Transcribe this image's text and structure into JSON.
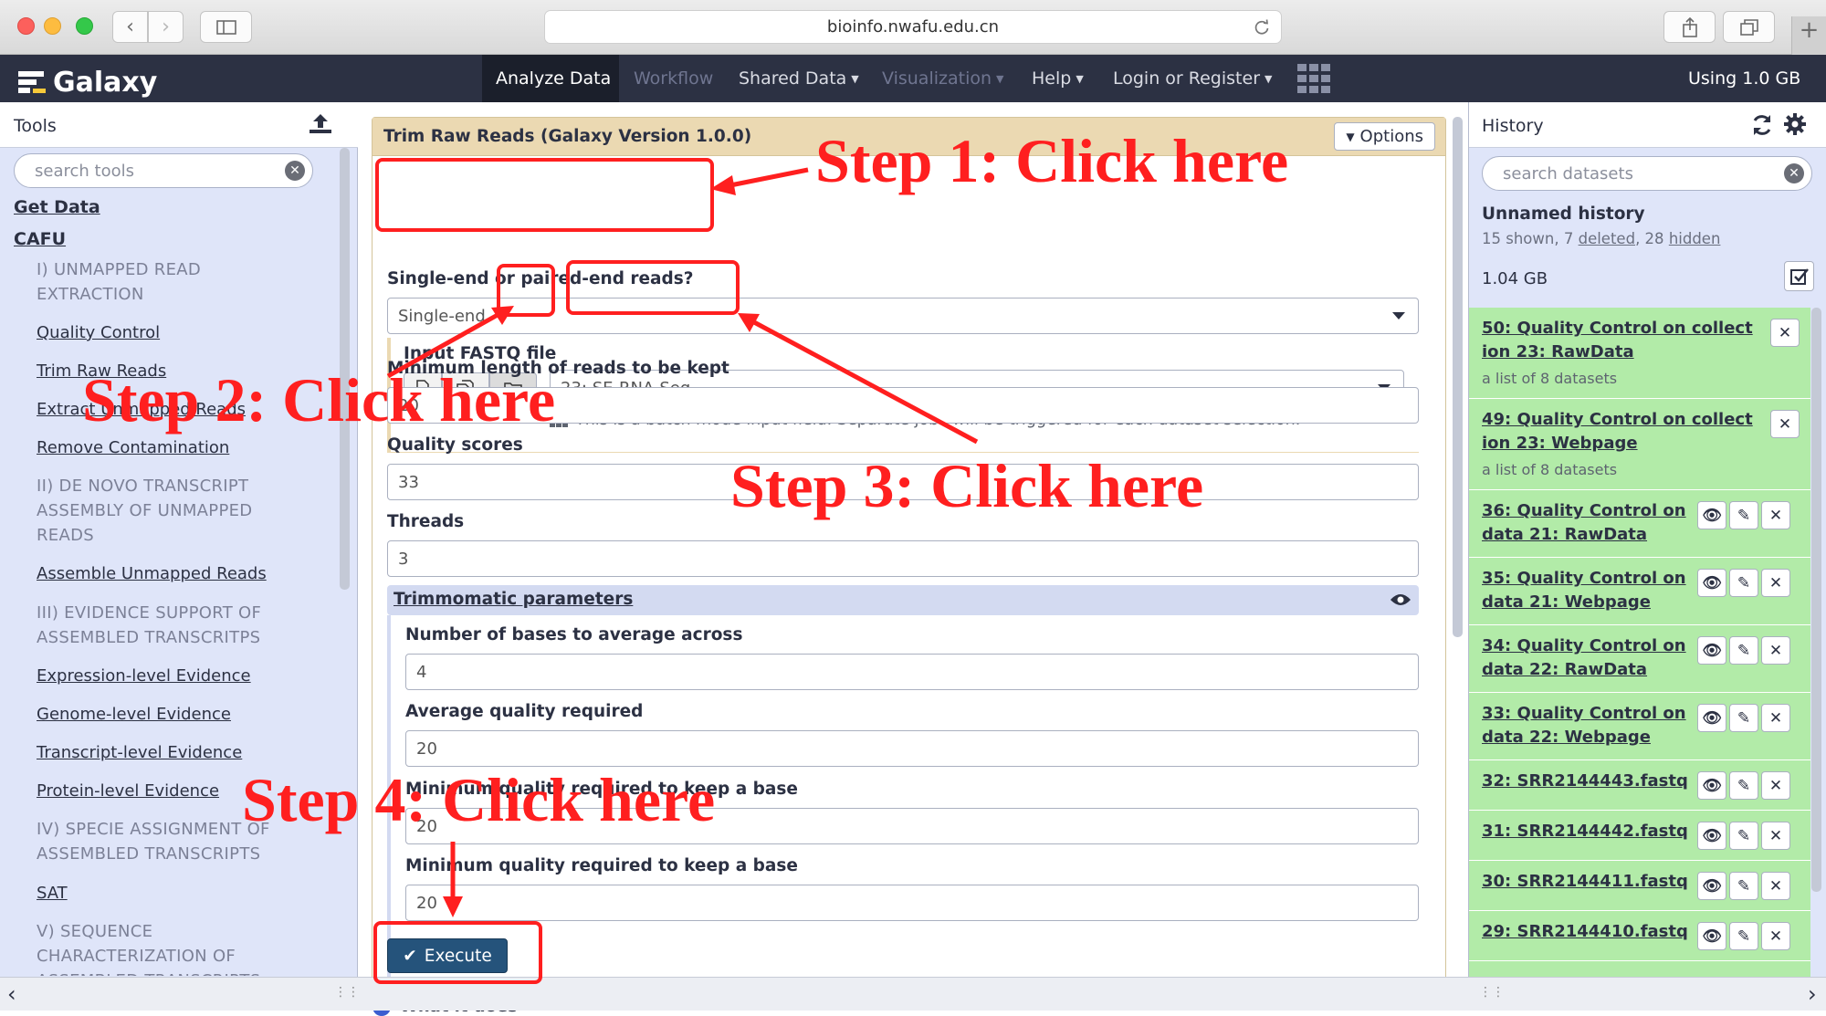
{
  "browser": {
    "url": "bioinfo.nwafu.edu.cn"
  },
  "masthead": {
    "brand": "Galaxy",
    "nav": [
      {
        "label": "Analyze Data"
      },
      {
        "label": "Workflow"
      },
      {
        "label": "Shared Data"
      },
      {
        "label": "Visualization"
      },
      {
        "label": "Help"
      },
      {
        "label": "Login or Register"
      }
    ],
    "usage": "Using 1.0 GB"
  },
  "tools": {
    "title": "Tools",
    "search_placeholder": "search tools",
    "items": [
      {
        "type": "head",
        "label": "Get Data"
      },
      {
        "type": "head",
        "label": "CAFU"
      },
      {
        "type": "section",
        "label": "I) UNMAPPED READ EXTRACTION"
      },
      {
        "type": "link",
        "label": "Quality Control"
      },
      {
        "type": "link",
        "label": "Trim Raw Reads"
      },
      {
        "type": "link",
        "label": "Extract Unmapped Reads"
      },
      {
        "type": "link",
        "label": "Remove Contamination"
      },
      {
        "type": "section",
        "label": "II) DE NOVO TRANSCRIPT ASSEMBLY OF UNMAPPED READS"
      },
      {
        "type": "link",
        "label": "Assemble Unmapped Reads"
      },
      {
        "type": "section",
        "label": "III) EVIDENCE SUPPORT OF ASSEMBLED TRANSCRITPS"
      },
      {
        "type": "link",
        "label": "Expression-level Evidence"
      },
      {
        "type": "link",
        "label": "Genome-level Evidence"
      },
      {
        "type": "link",
        "label": "Transcript-level Evidence"
      },
      {
        "type": "link",
        "label": "Protein-level Evidence"
      },
      {
        "type": "section",
        "label": "IV) SPECIE ASSIGNMENT OF ASSEMBLED TRANSCRIPTS"
      },
      {
        "type": "link",
        "label": "SAT"
      },
      {
        "type": "section",
        "label": "V) SEQUENCE CHARACTERIZATION OF ASSEMBLED TRANSCRIPTS"
      }
    ]
  },
  "form": {
    "title": "Trim Raw Reads (Galaxy Version 1.0.0)",
    "options_label": "Options",
    "reads_label": "Single-end or paired-end reads?",
    "reads_value": "Single-end",
    "fastq_label": "Input FASTQ file",
    "fastq_value": "23: SE-RNA-Seq",
    "batch_help": "This is a batch mode input field. Separate jobs will be triggered for each dataset selection.",
    "minlen_label": "Minimum length of reads to be kept",
    "minlen_value": "20",
    "qscore_label": "Quality scores",
    "qscore_value": "33",
    "threads_label": "Threads",
    "threads_value": "3",
    "trim_section": "Trimmomatic parameters",
    "bases_label": "Number of bases to average across",
    "bases_value": "4",
    "avgq_label": "Average quality required",
    "avgq_value": "20",
    "minq1_label": "Minimum quality required to keep a base",
    "minq1_value": "20",
    "minq2_label": "Minimum quality required to keep a base",
    "minq2_value": "20",
    "execute_label": "Execute",
    "what_label": "What it does"
  },
  "history": {
    "title": "History",
    "search_placeholder": "search datasets",
    "name": "Unnamed history",
    "shown": "15 shown, 7",
    "deleted": "deleted",
    "hidden_count": ", 28",
    "hidden": "hidden",
    "size": "1.04 GB",
    "items": [
      {
        "title": "50: Quality Control on collection 23: RawData",
        "title_l1": "50: Quality Control on collect",
        "title_l2": "ion 23: RawData",
        "sub": "a list of 8 datasets"
      },
      {
        "title": "49: Quality Control on collection 23: Webpage",
        "title_l1": "49: Quality Control on collect",
        "title_l2": "ion 23: Webpage",
        "sub": "a list of 8 datasets"
      },
      {
        "title_l1": "36: Quality Control on",
        "title_l2": "data 21: RawData"
      },
      {
        "title_l1": "35: Quality Control on",
        "title_l2": "data 21: Webpage"
      },
      {
        "title_l1": "34: Quality Control on",
        "title_l2": "data 22: RawData"
      },
      {
        "title_l1": "33: Quality Control on",
        "title_l2": "data 22: Webpage"
      },
      {
        "title_l1": "32: SRR2144443.fastq"
      },
      {
        "title_l1": "31: SRR2144442.fastq"
      },
      {
        "title_l1": "30: SRR2144411.fastq"
      },
      {
        "title_l1": "29: SRR2144410.fastq"
      }
    ]
  },
  "annotations": {
    "step1": "Step 1: Click here",
    "step2": "Step 2: Click here",
    "step3": "Step 3: Click here",
    "step4": "Step 4: Click here",
    "color": "#ff1f1f"
  },
  "colors": {
    "masthead": "#2c3143",
    "panel": "#dfe5f9",
    "form_header": "#ebd9b2",
    "history_ok": "#b2eba8",
    "execute": "#25537b"
  }
}
